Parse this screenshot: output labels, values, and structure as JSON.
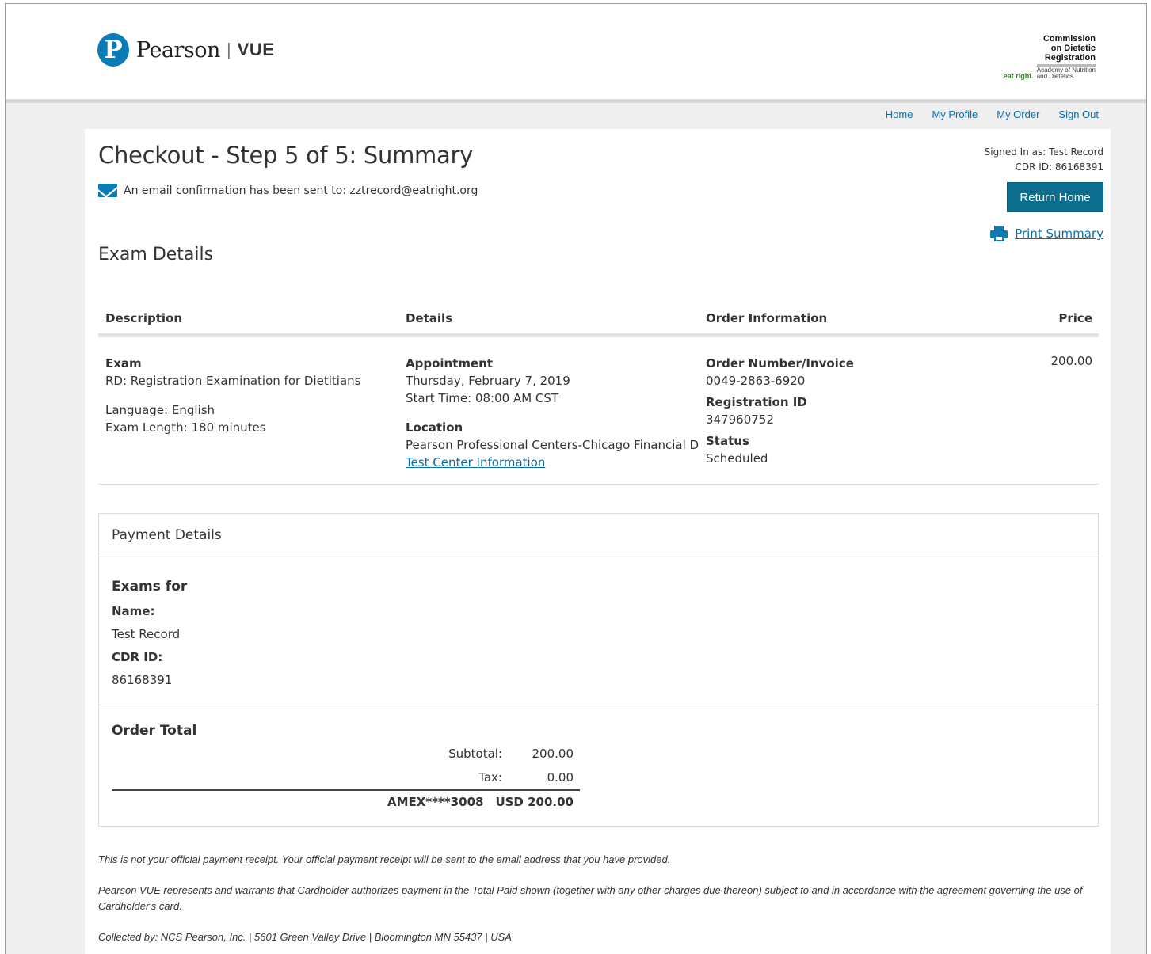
{
  "header": {
    "logo_letter": "P",
    "logo_name": "Pearson",
    "logo_separator": "|",
    "logo_product": "VUE",
    "partner_title": "Commission\non Dietetic\nRegistration",
    "partner_mark": "eat right.",
    "partner_academy": "Academy of Nutrition\nand Dietetics"
  },
  "nav": {
    "items": [
      "Home",
      "My Profile",
      "My Order",
      "Sign Out"
    ]
  },
  "page": {
    "title": "Checkout - Step 5 of 5: Summary",
    "email_confirmation": "An email confirmation has been sent to: zztrecord@eatright.org",
    "signed_in": "Signed In as: Test Record",
    "cdr_id_line": "CDR ID: 86168391",
    "return_home_label": "Return Home",
    "print_label": "Print Summary",
    "section_title": "Exam Details"
  },
  "exam_table": {
    "headers": [
      "Description",
      "Details",
      "Order Information",
      "Price"
    ],
    "row": {
      "exam_label": "Exam",
      "exam_name": "RD: Registration Examination for Dietitians",
      "language": "Language: English",
      "length": "Exam Length: 180 minutes",
      "appointment_label": "Appointment",
      "appointment_date": "Thursday, February 7, 2019",
      "start_time": "Start Time: 08:00 AM CST",
      "location_label": "Location",
      "location_name": "Pearson Professional Centers-Chicago Financial District",
      "test_center_link": "Test Center Information",
      "order_number_label": "Order Number/Invoice",
      "order_number": "0049-2863-6920",
      "registration_label": "Registration ID",
      "registration_id": "347960752",
      "status_label": "Status",
      "status": "Scheduled",
      "price": "200.00"
    }
  },
  "payment": {
    "title": "Payment Details",
    "exams_for_label": "Exams for",
    "name_label": "Name:",
    "name_value": "Test Record",
    "cdr_label": "CDR ID:",
    "cdr_value": "86168391",
    "order_total_label": "Order Total",
    "subtotal_label": "Subtotal:",
    "subtotal_value": "200.00",
    "tax_label": "Tax:",
    "tax_value": "0.00",
    "card": "AMEX****3008",
    "total": "USD 200.00"
  },
  "footer": {
    "receipt_note": "This is not your official payment receipt. Your official payment receipt will be sent to the email address that you have provided.",
    "warrant_note": "Pearson VUE represents and warrants that Cardholder authorizes payment in the Total Paid shown (together with any other charges due thereon) subject to and in accordance with the agreement governing the use of Cardholder's card.",
    "collected_by": "Collected by: NCS Pearson, Inc. | 5601 Green Valley Drive | Bloomington MN 55437 | USA"
  }
}
